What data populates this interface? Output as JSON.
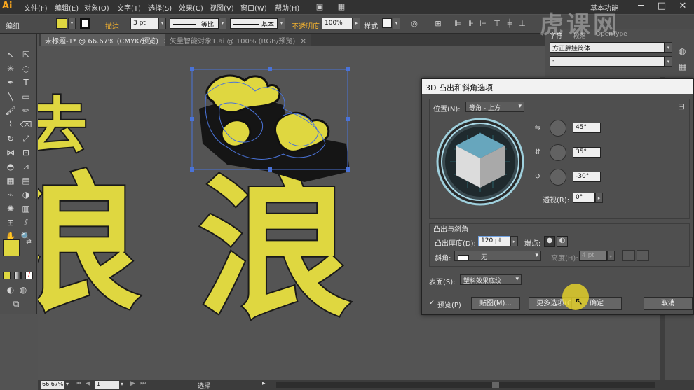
{
  "app": {
    "logo": "Ai"
  },
  "menu": [
    "文件(F)",
    "编辑(E)",
    "对象(O)",
    "文字(T)",
    "选择(S)",
    "效果(C)",
    "视图(V)",
    "窗口(W)",
    "帮助(H)"
  ],
  "workspace": "基本功能",
  "control_bar": {
    "group_label": "编组",
    "stroke_label": "描边",
    "stroke_value": "3 pt",
    "profile_label": "等比",
    "brush_label": "基本",
    "opacity_label": "不透明度",
    "opacity_value": "100%",
    "style_label": "样式",
    "fill_color": "#dfd740"
  },
  "tabs": [
    {
      "label": "未标题-1* @ 66.67% (CMYK/预览)"
    },
    {
      "label": "矢量智能对象1.ai @ 100% (RGB/预览)"
    }
  ],
  "right_panel": {
    "tab_char": "字符",
    "tab_para": "段落",
    "tab_opentype": "OpenType",
    "font_name": "方正胖娃简体",
    "font_style": "-"
  },
  "canvas_text": {
    "left_top": "去",
    "left_big": "浪",
    "center_big": "浪"
  },
  "dialog": {
    "title": "3D 凸出和斜角选项",
    "position_label": "位置(N):",
    "position_value": "等角 - 上方",
    "angle_x": "45°",
    "angle_y": "35°",
    "angle_z": "-30°",
    "perspective_label": "透视(R):",
    "perspective_value": "0°",
    "extrude_section": "凸出与斜角",
    "extrude_depth_label": "凸出厚度(D):",
    "extrude_depth_value": "120 pt",
    "cap_label": "端点:",
    "bevel_label": "斜角:",
    "bevel_value": "无",
    "height_label": "高度(H):",
    "height_value": "4 pt",
    "surface_label": "表面(S):",
    "surface_value": "塑料效果底纹",
    "preview_label": "预览(P)",
    "map_button": "贴图(M)...",
    "more_button": "更多选项(O)",
    "ok_button": "确定",
    "cancel_button": "取消"
  },
  "status_bar": {
    "zoom": "66.67%",
    "page": "1",
    "mode": "选择"
  },
  "watermark": "虎课网"
}
